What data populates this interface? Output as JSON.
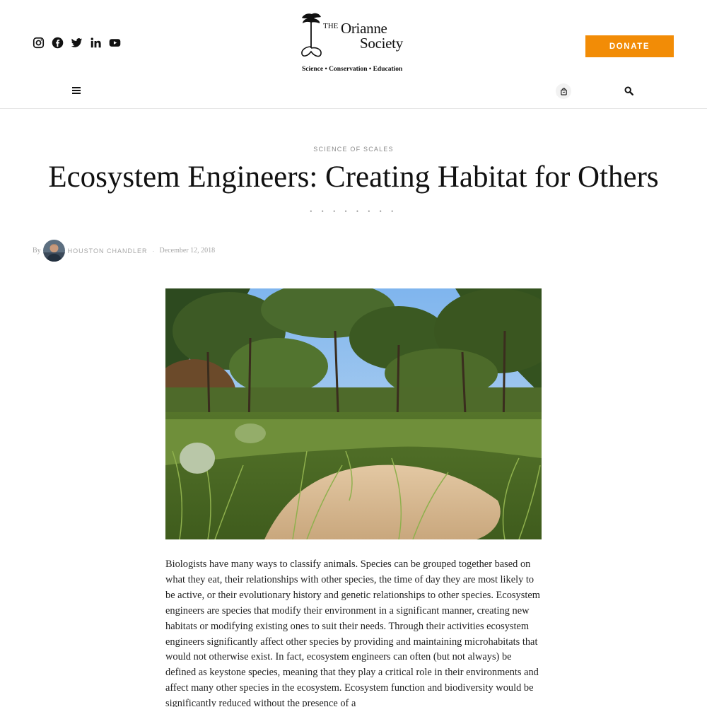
{
  "header": {
    "social": [
      "instagram-icon",
      "facebook-icon",
      "twitter-icon",
      "linkedin-icon",
      "youtube-icon"
    ],
    "logo": {
      "the": "THE",
      "name_line1": "Orianne",
      "name_line2": "Society",
      "tagline": "Science • Conservation • Education"
    },
    "donate_label": "DONATE",
    "accent_color": "#f28c06"
  },
  "article": {
    "category": "SCIENCE OF SCALES",
    "title": "Ecosystem Engineers: Creating Habitat for Others",
    "dots": "• • • • • • • •",
    "by": "By",
    "author": "HOUSTON CHANDLER",
    "separator": "·",
    "date": "December 12, 2018",
    "body": "Biologists have many ways to classify animals.  Species can be grouped together based on what they eat, their relationships with other species, the time of day they are most likely to be active, or their evolutionary history and genetic relationships to other species.  Ecosystem engineers are species that modify their environment in a significant manner, creating new habitats or modifying existing ones to suit their needs.  Through their activities ecosystem engineers significantly affect other species by providing and maintaining microhabitats that would not otherwise exist.  In fact, ecosystem engineers can often (but not always) be defined as keystone species, meaning that they play a critical role in their environments and affect many other species in the ecosystem.  Ecosystem function and biodiversity would be significantly reduced without the presence of a"
  }
}
